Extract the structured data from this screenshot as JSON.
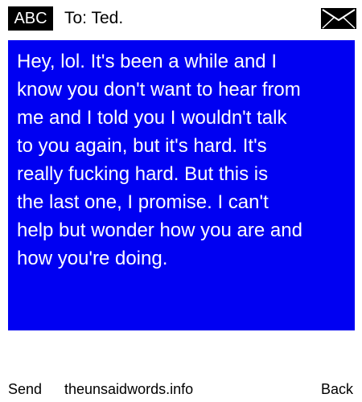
{
  "header": {
    "mode_label": "ABC",
    "recipient": "To: Ted."
  },
  "icons": {
    "envelope": "envelope-icon"
  },
  "colors": {
    "message_background": "#0000f2",
    "message_text": "#ffffff",
    "badge_background": "#000000"
  },
  "message": {
    "text": "Hey, lol. It's been a while and I\nknow you don't want to hear from\nme and I told you I wouldn't talk\nto you again, but it's hard. It's\nreally fucking hard. But this is\nthe last one, I promise. I can't\nhelp but wonder how you are and\nhow you're doing."
  },
  "softkeys": {
    "left": "Send",
    "center": "theunsaidwords.info",
    "right": "Back"
  }
}
